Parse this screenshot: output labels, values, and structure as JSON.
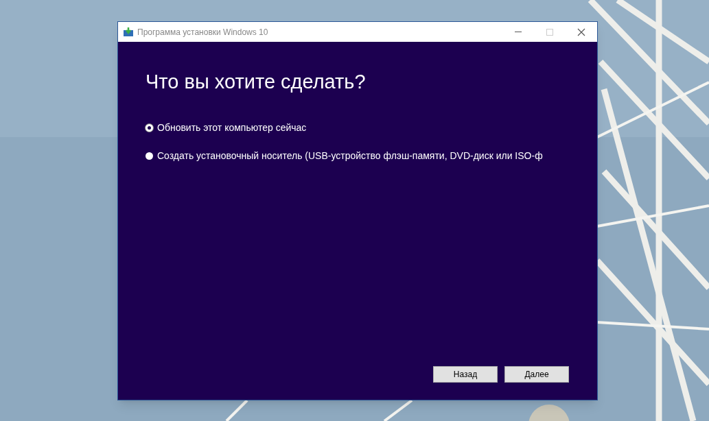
{
  "window": {
    "title": "Программа установки Windows 10"
  },
  "heading": "Что вы хотите сделать?",
  "options": [
    {
      "label": "Обновить этот компьютер сейчас",
      "selected": true
    },
    {
      "label": "Создать установочный носитель (USB-устройство флэш-памяти, DVD-диск или ISO-ф",
      "selected": false
    }
  ],
  "buttons": [
    {
      "label": "Назад"
    },
    {
      "label": "Далее"
    }
  ]
}
